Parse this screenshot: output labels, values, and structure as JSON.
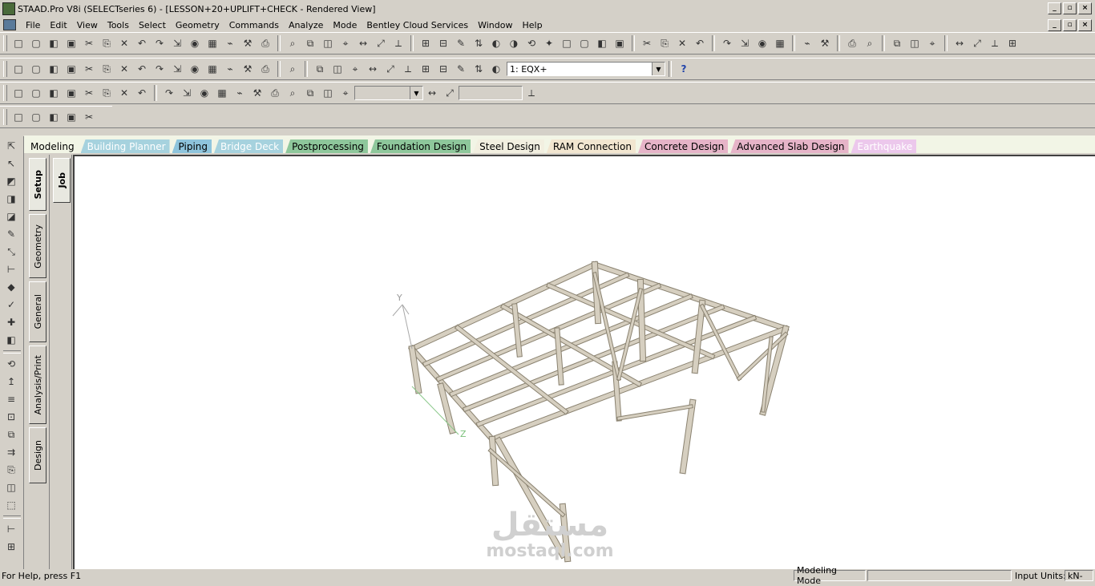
{
  "window": {
    "title": "STAAD.Pro V8i (SELECTseries 6) - [LESSON+20+UPLIFT+CHECK - Rendered View]"
  },
  "menu": [
    "File",
    "Edit",
    "View",
    "Tools",
    "Select",
    "Geometry",
    "Commands",
    "Analyze",
    "Mode",
    "Bentley Cloud Services",
    "Window",
    "Help"
  ],
  "toolbar": {
    "load_case": "1: EQX+",
    "help_icon": "help-icon"
  },
  "page_tabs": [
    {
      "label": "Modeling",
      "color": "#f2f5e6",
      "text": "#000000"
    },
    {
      "label": "Building Planner",
      "color": "#a6d2de",
      "text": "#ffffff"
    },
    {
      "label": "Piping",
      "color": "#8ec4dc",
      "text": "#000000"
    },
    {
      "label": "Bridge Deck",
      "color": "#a6d2de",
      "text": "#ffffff"
    },
    {
      "label": "Postprocessing",
      "color": "#8ec79b",
      "text": "#000000"
    },
    {
      "label": "Foundation Design",
      "color": "#8ec79b",
      "text": "#000000"
    },
    {
      "label": "Steel Design",
      "color": "#f2efe0",
      "text": "#000000"
    },
    {
      "label": "RAM Connection",
      "color": "#f2e6d0",
      "text": "#000000"
    },
    {
      "label": "Concrete Design",
      "color": "#e6b4c8",
      "text": "#000000"
    },
    {
      "label": "Advanced Slab Design",
      "color": "#e6b4c8",
      "text": "#000000"
    },
    {
      "label": "Earthquake",
      "color": "#ecc8ec",
      "text": "#ffffff"
    }
  ],
  "side_tabs": [
    {
      "label": "Setup"
    },
    {
      "label": "Geometry"
    },
    {
      "label": "General"
    },
    {
      "label": "Analysis/Print"
    },
    {
      "label": "Design"
    }
  ],
  "job_tab": {
    "label": "Job"
  },
  "axes": {
    "y": "Y",
    "z": "Z"
  },
  "watermark": {
    "arabic": "مستقل",
    "latin": "mostaql.com"
  },
  "status": {
    "help": "For Help, press F1",
    "mode": "Modeling Mode",
    "input_units": "Input Units:",
    "units_value": "kN-"
  },
  "colors": {
    "member": "#d6cfc0",
    "member_edge": "#8a8270",
    "viewport_bg": "#ffffff"
  }
}
